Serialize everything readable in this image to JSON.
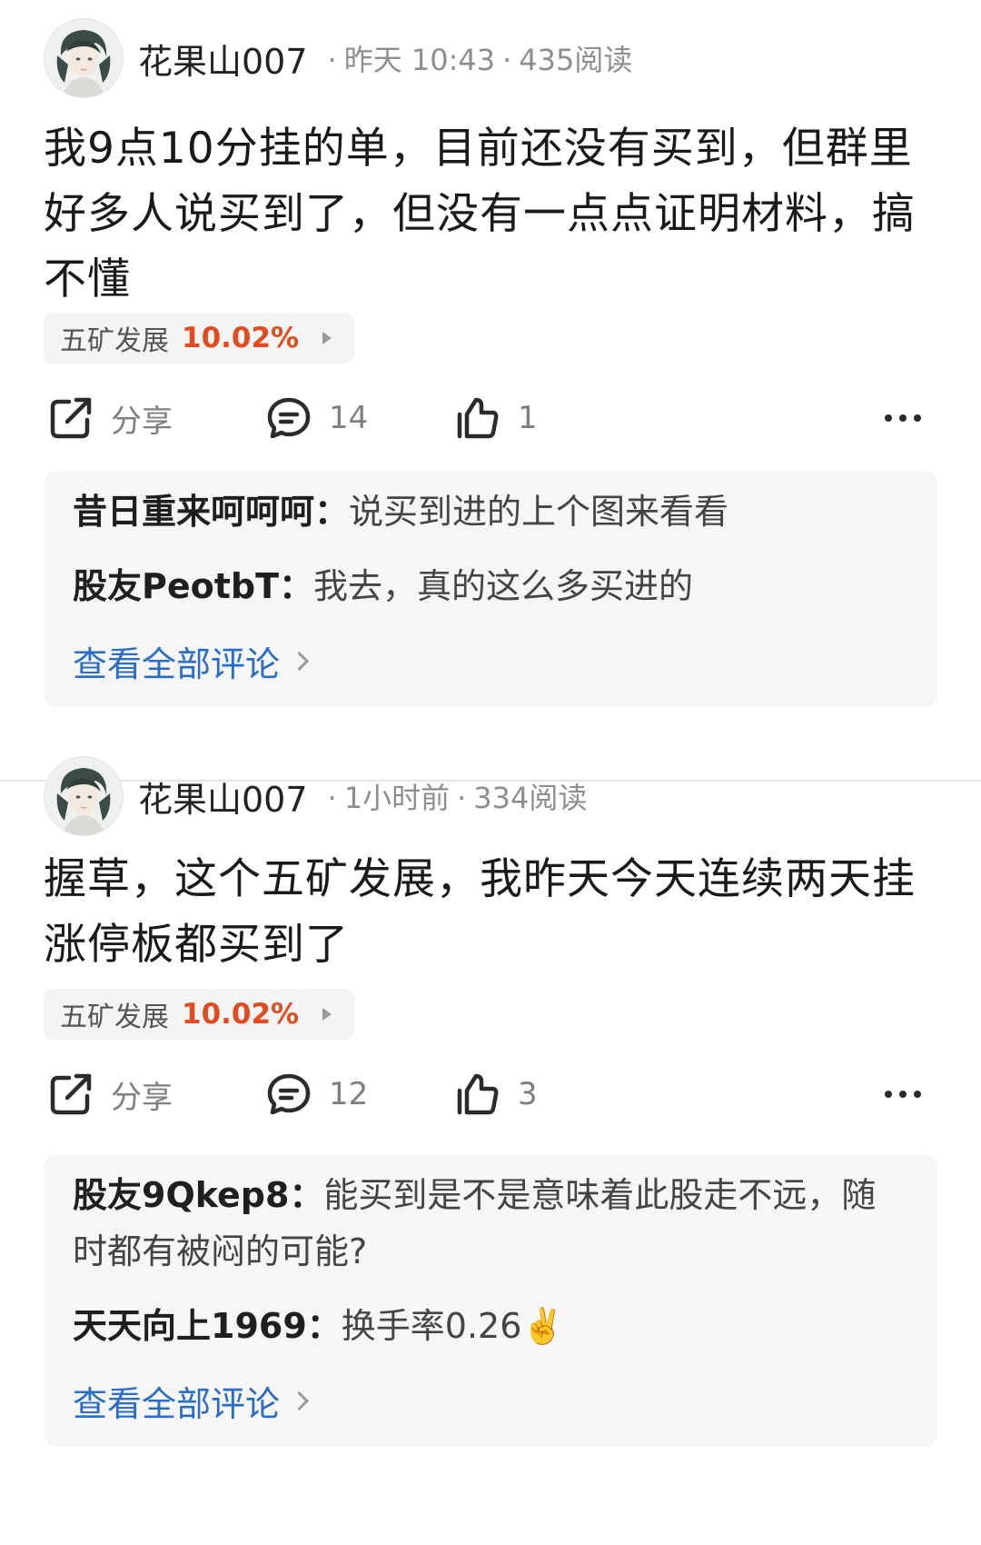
{
  "posts": [
    {
      "username": "花果山007",
      "time": "昨天 10:43",
      "reads": "435阅读",
      "content": "我9点10分挂的单，目前还没有买到，但群里好多人说买到了，但没有一点点证明材料，搞不懂",
      "stock": {
        "name": "五矿发展",
        "change": "10.02%"
      },
      "actions": {
        "share_label": "分享",
        "comments_count": "14",
        "likes_count": "1"
      },
      "comments": [
        {
          "author": "昔日重来呵呵呵：",
          "text": "说买到进的上个图来看看"
        },
        {
          "author": "股友PeotbT：",
          "text": "我去，真的这么多买进的"
        }
      ],
      "view_all": "查看全部评论"
    },
    {
      "username": "花果山007",
      "time": "1小时前",
      "reads": "334阅读",
      "content": "握草，这个五矿发展，我昨天今天连续两天挂涨停板都买到了",
      "stock": {
        "name": "五矿发展",
        "change": "10.02%"
      },
      "actions": {
        "share_label": "分享",
        "comments_count": "12",
        "likes_count": "3"
      },
      "comments": [
        {
          "author": "股友9Qkep8：",
          "text": "能买到是不是意味着此股走不远，随时都有被闷的可能?"
        },
        {
          "author": "天天向上1969：",
          "text": "换手率0.26✌️"
        }
      ],
      "view_all": "查看全部评论"
    }
  ],
  "colors": {
    "stock_change": "#e04b1f",
    "link": "#2a6dc9",
    "meta": "#8e8e8e"
  },
  "icons": {
    "share": "share-icon",
    "comment": "comment-icon",
    "like": "thumbs-up-icon",
    "more": "more-dots-icon"
  }
}
